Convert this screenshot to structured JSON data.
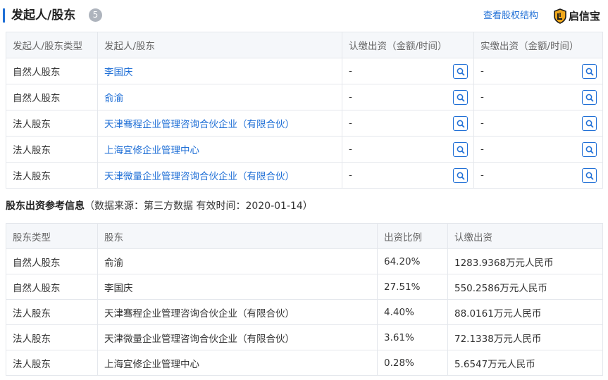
{
  "header": {
    "title": "发起人/股东",
    "count": "5",
    "equity_link": "查看股权结构",
    "brand_name": "启信宝",
    "brand_icon": "shield-logo-icon",
    "accent_color": "#1f6fd6"
  },
  "founders_table": {
    "columns": [
      "发起人/股东类型",
      "发起人/股东",
      "认缴出资（金额/时间）",
      "实缴出资（金额/时间）"
    ],
    "rows": [
      {
        "type": "自然人股东",
        "name": "李国庆",
        "subscribed": "-",
        "paid": "-"
      },
      {
        "type": "自然人股东",
        "name": "俞渝",
        "subscribed": "-",
        "paid": "-"
      },
      {
        "type": "法人股东",
        "name": "天津骞程企业管理咨询合伙企业（有限合伙）",
        "subscribed": "-",
        "paid": "-"
      },
      {
        "type": "法人股东",
        "name": "上海宜修企业管理中心",
        "subscribed": "-",
        "paid": "-"
      },
      {
        "type": "法人股东",
        "name": "天津微量企业管理咨询合伙企业（有限合伙）",
        "subscribed": "-",
        "paid": "-"
      }
    ]
  },
  "reference_info": {
    "title": "股东出资参考信息",
    "note": "（数据来源：第三方数据 有效时间：2020-01-14）"
  },
  "contribution_table": {
    "columns": [
      "股东类型",
      "股东",
      "出资比例",
      "认缴出资"
    ],
    "rows": [
      {
        "type": "自然人股东",
        "name": "俞渝",
        "ratio": "64.20%",
        "amount": "1283.9368万元人民币"
      },
      {
        "type": "自然人股东",
        "name": "李国庆",
        "ratio": "27.51%",
        "amount": "550.2586万元人民币"
      },
      {
        "type": "法人股东",
        "name": "天津骞程企业管理咨询合伙企业（有限合伙）",
        "ratio": "4.40%",
        "amount": "88.0161万元人民币"
      },
      {
        "type": "法人股东",
        "name": "天津微量企业管理咨询合伙企业（有限合伙）",
        "ratio": "3.61%",
        "amount": "72.1338万元人民币"
      },
      {
        "type": "法人股东",
        "name": "上海宜修企业管理中心",
        "ratio": "0.28%",
        "amount": "5.6547万元人民币"
      }
    ]
  }
}
